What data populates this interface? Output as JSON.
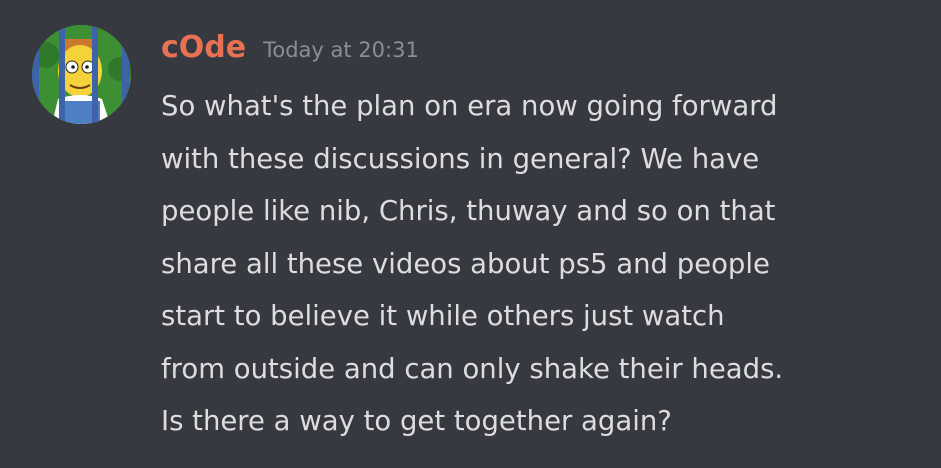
{
  "message": {
    "author": "cOde",
    "timestamp": "Today at 20:31",
    "lines": [
      "So what's the plan on era now going forward",
      "with these discussions in general? We have",
      "people like nib, Chris, thuway and so on that",
      "share all these videos about ps5 and people",
      "start to believe it while others just watch",
      "from outside and can only shake their heads.",
      "Is there a way to get together again?"
    ]
  },
  "colors": {
    "background": "#36393f",
    "username": "#e87153",
    "timestamp": "#8b8e92",
    "text": "#dcddde"
  },
  "icons": {
    "avatar": "cartoon-character-behind-bars-avatar"
  }
}
